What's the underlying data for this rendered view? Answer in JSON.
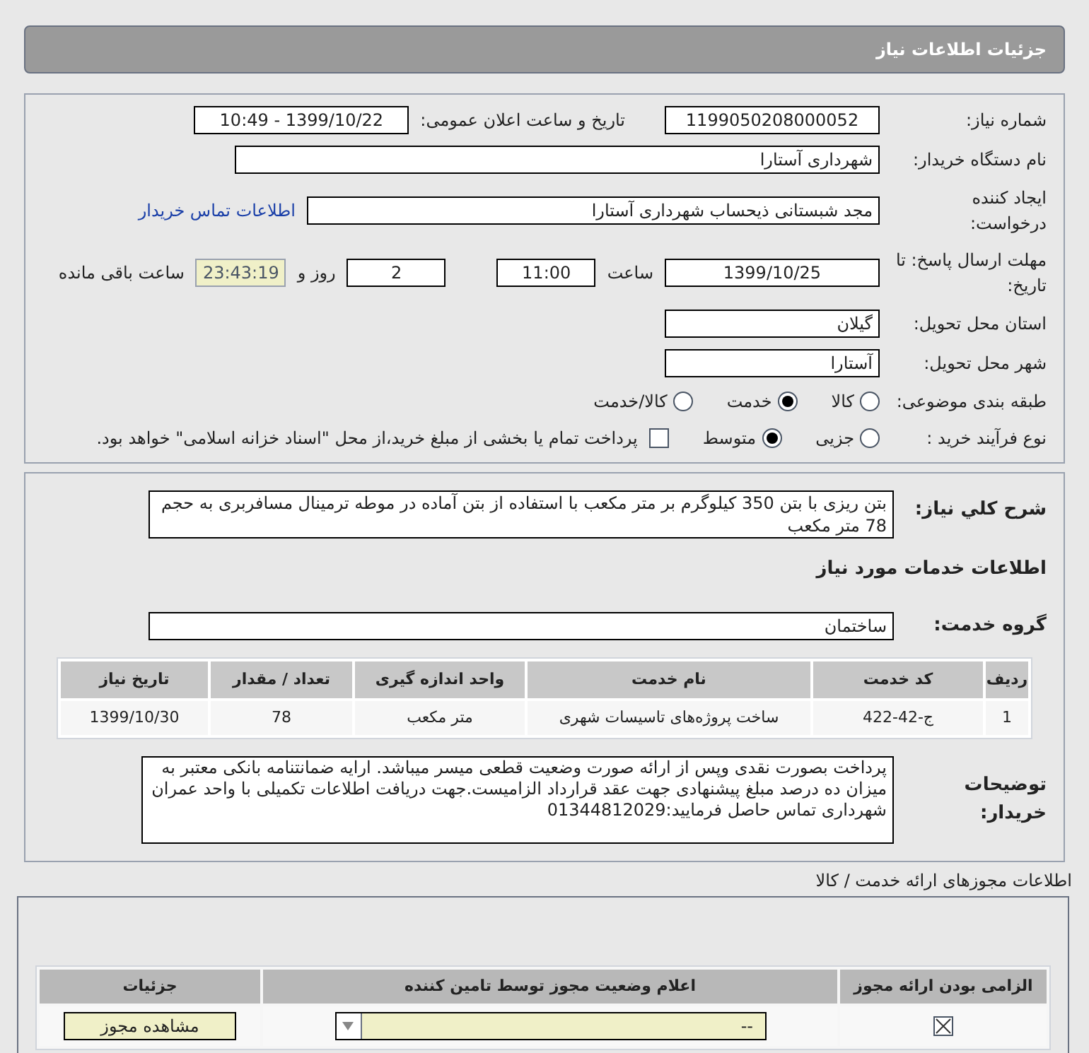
{
  "header": {
    "title": "جزئیات اطلاعات نیاز"
  },
  "fields": {
    "need_number": {
      "label": "شماره نیاز:",
      "value": "1199050208000052"
    },
    "announce": {
      "label": "تاریخ و ساعت اعلان عمومی:",
      "value": "1399/10/22 - 10:49"
    },
    "buyer": {
      "label": "نام دستگاه خریدار:",
      "value": "شهرداری آستارا"
    },
    "creator": {
      "label": "ایجاد کننده درخواست:",
      "value": "مجد شبستانی ذیحساب شهرداری آستارا",
      "link": "اطلاعات تماس خریدار"
    },
    "deadline": {
      "label": "مهلت ارسال پاسخ: تا تاریخ:",
      "date": "1399/10/25",
      "time_label": "ساعت",
      "time": "11:00",
      "days": "2",
      "days_label": "روز و",
      "remaining": "23:43:19",
      "remaining_label": "ساعت باقی مانده"
    },
    "province": {
      "label": "استان محل تحویل:",
      "value": "گیلان"
    },
    "city": {
      "label": "شهر محل تحویل:",
      "value": "آستارا"
    }
  },
  "category": {
    "label": "طبقه بندی موضوعی:",
    "options": [
      {
        "label": "کالا",
        "selected": false
      },
      {
        "label": "خدمت",
        "selected": true
      },
      {
        "label": "کالا/خدمت",
        "selected": false
      }
    ]
  },
  "process": {
    "label": "نوع فرآیند خرید :",
    "options": [
      {
        "label": "جزیی",
        "selected": false
      },
      {
        "label": "متوسط",
        "selected": true
      }
    ],
    "payment": {
      "checked": false,
      "label": "پرداخت تمام یا بخشی از مبلغ خرید،از محل \"اسناد خزانه اسلامی\" خواهد بود."
    }
  },
  "description": {
    "label": "شرح کلي نياز:",
    "value": "بتن ریزی با بتن 350 کیلوگرم بر متر مکعب با استفاده از بتن آماده در موطه ترمینال مسافربری به حجم 78 متر مکعب"
  },
  "services_heading": "اطلاعات خدمات مورد نياز",
  "service_group": {
    "label": "گروه خدمت:",
    "value": "ساختمان"
  },
  "table": {
    "columns": [
      "ردیف",
      "کد خدمت",
      "نام خدمت",
      "واحد اندازه گیری",
      "تعداد / مقدار",
      "تاریخ نیاز"
    ],
    "rows": [
      [
        "1",
        "ج-42-422",
        "ساخت پروژه‌های تاسیسات شهری",
        "متر مکعب",
        "78",
        "1399/10/30"
      ]
    ]
  },
  "buyer_notes": {
    "label": "توضیحات خریدار:",
    "value": "پرداخت بصورت نقدی وپس از ارائه صورت وضعیت قطعی میسر میباشد. ارایه ضمانتنامه بانکی معتبر به میزان ده درصد مبلغ پیشنهادی جهت عقد قرارداد الزامیست.جهت دریافت اطلاعات تکمیلی با واحد عمران شهرداری تماس حاصل فرمایید:01344812029"
  },
  "permits": {
    "heading": "اطلاعات مجوزهای ارائه خدمت / کالا",
    "columns": [
      "الزامی بودن ارائه مجوز",
      "اعلام وضعیت مجوز توسط تامین کننده",
      "جزئیات"
    ],
    "rows": [
      {
        "required": true,
        "status": "--",
        "button": "مشاهده مجوز"
      }
    ]
  }
}
